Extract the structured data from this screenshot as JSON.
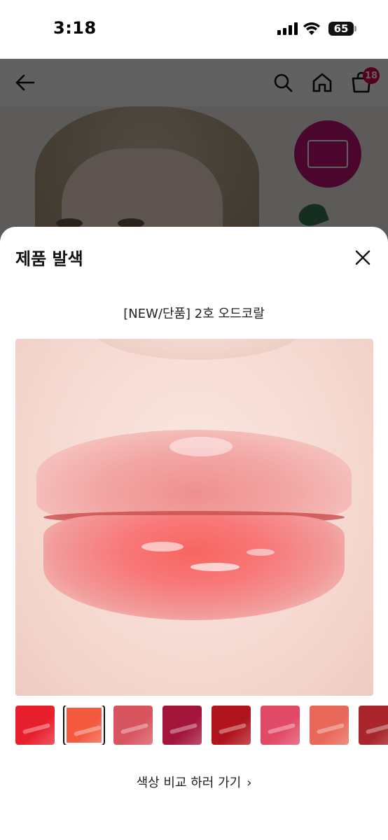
{
  "status_bar": {
    "time": "3:18",
    "battery": "65"
  },
  "header": {
    "cart_badge": "18"
  },
  "sheet": {
    "title": "제품 발색",
    "product_name": "[NEW/단품] 2호 오드코랄",
    "compare_label": "색상 비교 하러 가기",
    "compare_chevron": "›"
  },
  "swatches": [
    {
      "color": "#e8202e",
      "selected": false
    },
    {
      "color": "#f2593f",
      "selected": true
    },
    {
      "color": "#d85560",
      "selected": false
    },
    {
      "color": "#a3153a",
      "selected": false
    },
    {
      "color": "#b0141d",
      "selected": false
    },
    {
      "color": "#e04a66",
      "selected": false
    },
    {
      "color": "#e8685a",
      "selected": false
    },
    {
      "color": "#a8262c",
      "selected": false
    }
  ]
}
